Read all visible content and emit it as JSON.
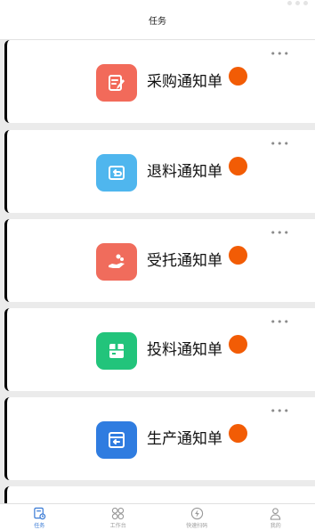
{
  "header": {
    "title": "任务"
  },
  "tasks": [
    {
      "label": "采购通知单",
      "icon": "edit-note-icon",
      "color": "#f26a5a"
    },
    {
      "label": "退料通知单",
      "icon": "return-box-icon",
      "color": "#4fb6ee"
    },
    {
      "label": "受托通知单",
      "icon": "hand-coins-icon",
      "color": "#f06c5c"
    },
    {
      "label": "投料通知单",
      "icon": "package-icon",
      "color": "#22c47b"
    },
    {
      "label": "生产通知单",
      "icon": "inbox-return-icon",
      "color": "#2f7ce0"
    }
  ],
  "more_label": "•••",
  "badge_color": "#f25c05",
  "tabbar": {
    "tabs": [
      {
        "label": "任务",
        "icon": "task-icon",
        "active": true
      },
      {
        "label": "工作台",
        "icon": "grid-icon",
        "active": false
      },
      {
        "label": "快速扫码",
        "icon": "lightning-icon",
        "active": false
      },
      {
        "label": "我的",
        "icon": "user-icon",
        "active": false
      }
    ]
  }
}
